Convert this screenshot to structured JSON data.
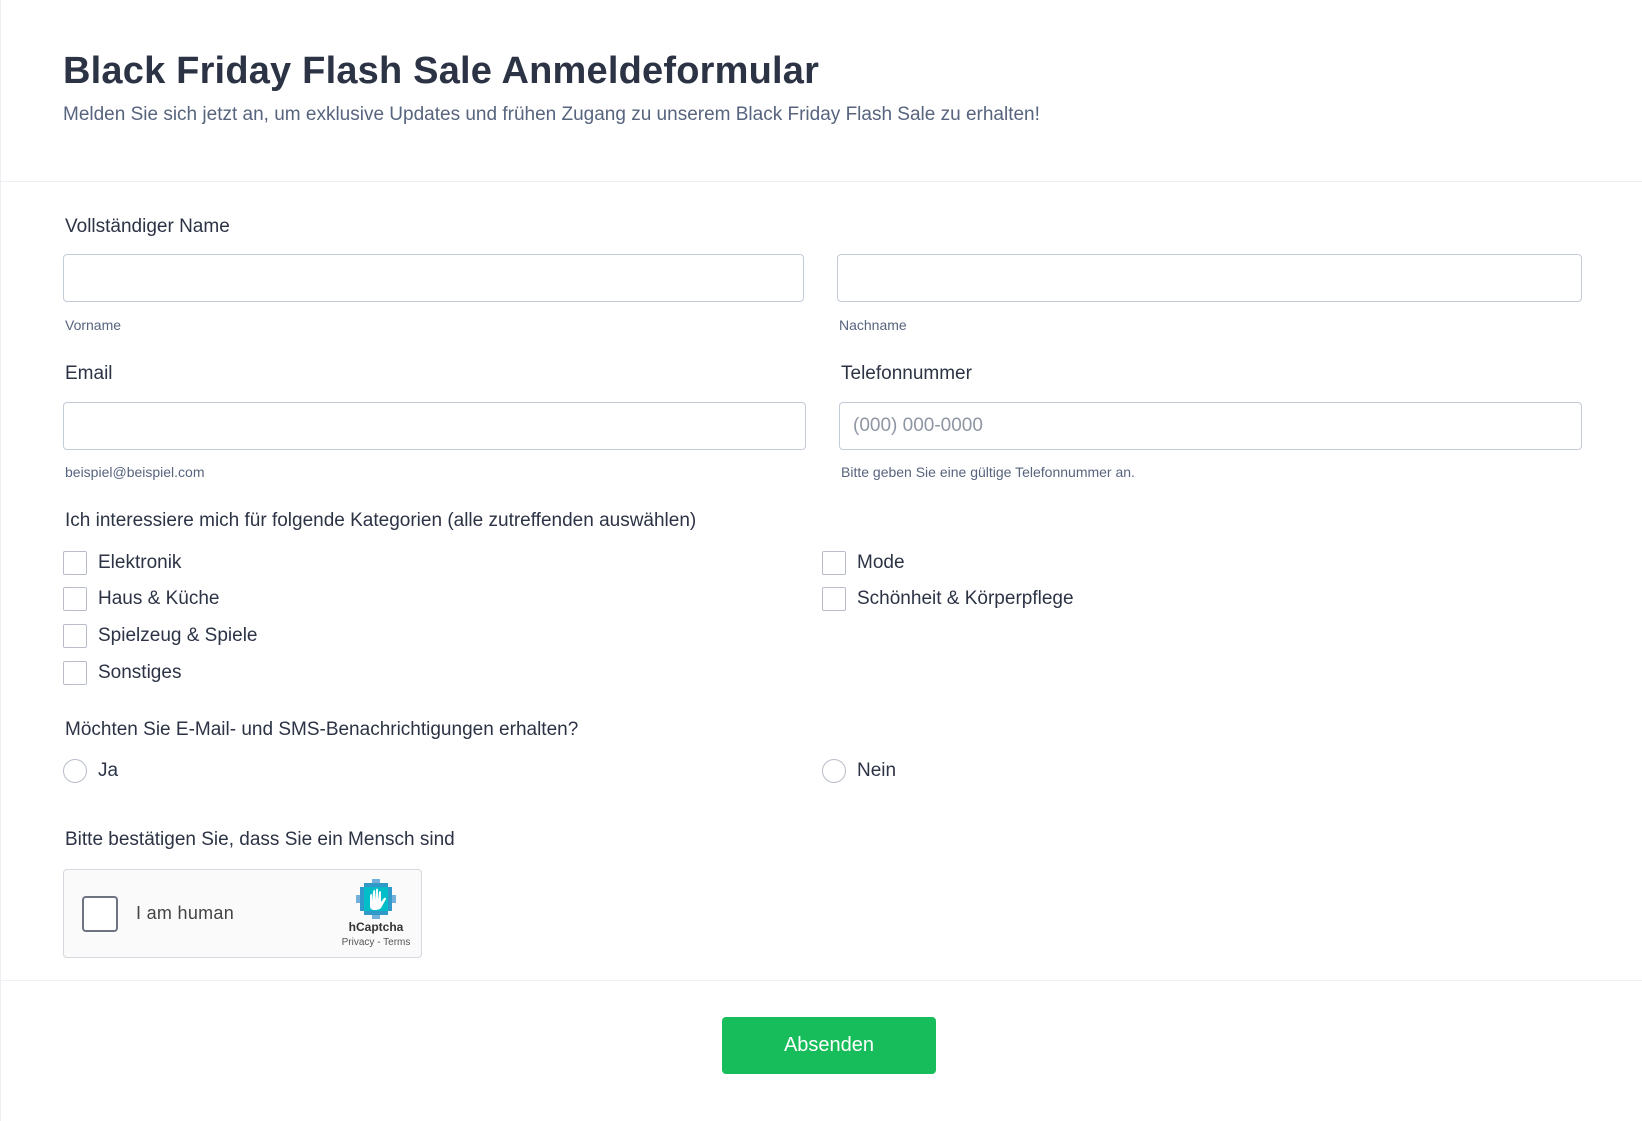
{
  "form": {
    "title": "Black Friday Flash Sale Anmeldeformular",
    "subtitle": "Melden Sie sich jetzt an, um exklusive Updates und frühen Zugang zu unserem Black Friday Flash Sale zu erhalten!"
  },
  "full_name": {
    "label": "Vollständiger Name",
    "first_name": {
      "value": "",
      "sublabel": "Vorname"
    },
    "last_name": {
      "value": "",
      "sublabel": "Nachname"
    }
  },
  "email": {
    "label": "Email",
    "value": "",
    "sublabel": "beispiel@beispiel.com"
  },
  "phone": {
    "label": "Telefonnummer",
    "value": "",
    "placeholder": "(000) 000-0000",
    "sublabel": "Bitte geben Sie eine gültige Telefonnummer an."
  },
  "categories": {
    "label": "Ich interessiere mich für folgende Kategorien (alle zutreffenden auswählen)",
    "options": [
      "Elektronik",
      "Mode",
      "Haus & Küche",
      "Schönheit & Körperpflege",
      "Spielzeug & Spiele",
      "Sonstiges"
    ],
    "checked": [
      false,
      false,
      false,
      false,
      false,
      false
    ]
  },
  "notifications": {
    "label": "Möchten Sie E-Mail- und SMS-Benachrichtigungen erhalten?",
    "options": [
      "Ja",
      "Nein"
    ],
    "selected": null
  },
  "captcha": {
    "label": "Bitte bestätigen Sie, dass Sie ein Mensch sind",
    "checkbox_text": "I am human",
    "brand": "hCaptcha",
    "links": "Privacy - Terms",
    "logo_icon": "hcaptcha-hand-icon"
  },
  "submit": {
    "label": "Absenden",
    "color": "#18bd5b"
  },
  "colors": {
    "text": "#2c3345",
    "muted": "#57647e",
    "border": "#c3cad8"
  }
}
